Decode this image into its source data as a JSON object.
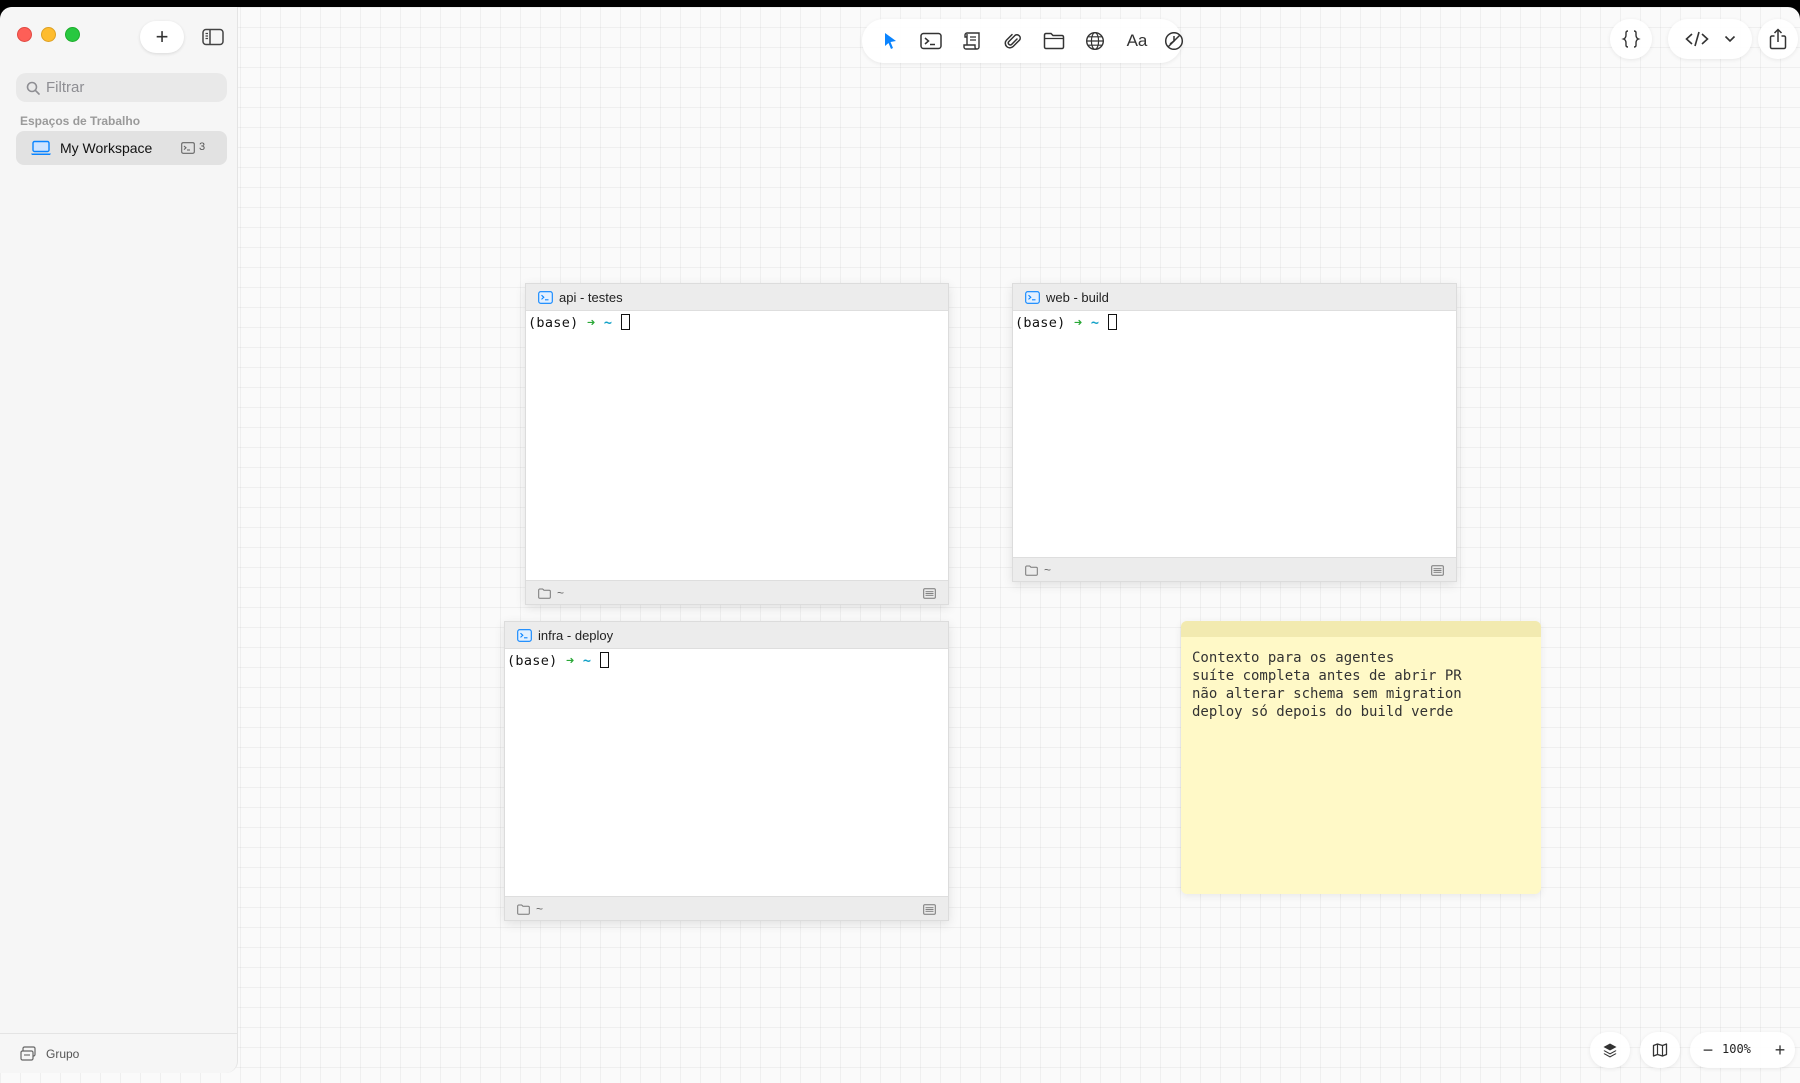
{
  "sidebar": {
    "new_button_label": "+",
    "search_placeholder": "Filtrar",
    "workspaces_label": "Espaços de Trabalho",
    "workspace": {
      "name": "My Workspace",
      "count": "3"
    },
    "group_label": "Grupo"
  },
  "toolbar": {
    "tools": [
      "pointer-icon",
      "terminal-icon",
      "script-icon",
      "paperclip-icon",
      "folder-icon",
      "globe-icon",
      "text-icon",
      "clock-icon"
    ],
    "text_tool_label": "Aa"
  },
  "right_toolbar": {
    "tools": [
      "braces-icon",
      "code-icon",
      "chevron-down-icon",
      "share-icon"
    ]
  },
  "terminals": [
    {
      "title": "api - testes",
      "prompt_env": "(base)",
      "prompt_arrow": "➜",
      "prompt_dir": "~",
      "footer_path": "~"
    },
    {
      "title": "web - build",
      "prompt_env": "(base)",
      "prompt_arrow": "➜",
      "prompt_dir": "~",
      "footer_path": "~"
    },
    {
      "title": "infra - deploy",
      "prompt_env": "(base)",
      "prompt_arrow": "➜",
      "prompt_dir": "~",
      "footer_path": "~"
    }
  ],
  "note": {
    "lines": [
      "Contexto para os agentes",
      "suíte completa antes de abrir PR",
      "não alterar schema sem migration",
      "deploy só depois do build verde"
    ]
  },
  "bottom_controls": {
    "zoom_out_label": "−",
    "zoom_level": "100%",
    "zoom_in_label": "+"
  },
  "colors": {
    "accent": "#0a84ff",
    "note_background": "#fff9c7",
    "prompt_arrow": "#2aa837",
    "prompt_dir": "#12a1c7"
  }
}
